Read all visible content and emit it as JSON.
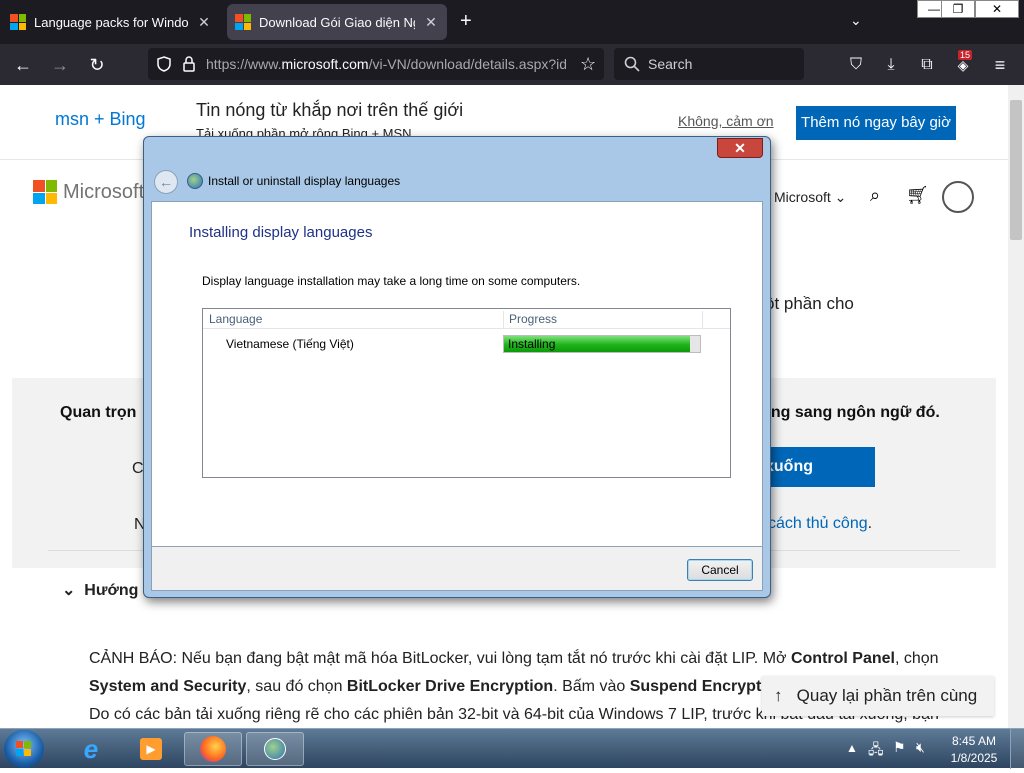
{
  "browser": {
    "tabs": [
      {
        "label": "Language packs for Windows - Mic",
        "active": false
      },
      {
        "label": "Download Gói Giao diện Ngôn ngữ",
        "active": true
      }
    ],
    "url_prefix": "https://www.",
    "url_host": "microsoft.com",
    "url_rest": "/vi-VN/download/details.aspx?id=",
    "search_placeholder": "Search",
    "extensions_badge": "15",
    "window_controls": [
      "—",
      "❐",
      "✕"
    ]
  },
  "page": {
    "banner_brand": "msn + Bing",
    "banner_title": "Tin nóng từ khắp nơi trên thế giới",
    "banner_subtitle": "Tải xuống phần mở rộng Bing + MSN",
    "no_thanks": "Không, cảm ơn",
    "add_now": "Thêm nó ngay bây giờ",
    "ms_logo_text": "Microsoft",
    "all_microsoft": "Microsoft",
    "partial_text_right": "ột phần cho",
    "important_left": "Quan trọn",
    "important_right": "ang sang ngôn ngữ đó.",
    "left_c": "C",
    "left_n": "N",
    "download_btn": "xuống",
    "manual_link": "cách thủ công",
    "guide_left": "Hướng",
    "warning_prefix": "CẢNH BÁO: Nếu bạn đang bật mật mã hóa BitLocker, vui lòng tạm tắt nó trước khi cài đặt LIP. Mở ",
    "warning_b1": "Control Panel",
    "warning_mid1": ", chọn ",
    "warning_b2": "System and Security",
    "warning_mid2": ", sau đó chọn ",
    "warning_b3": "BitLocker Drive Encryption",
    "warning_mid3": ". Bấm vào ",
    "warning_b4": "Suspend Encryption",
    "warning_next": "Do có các bản tải xuống riêng rẽ cho các phiên bản 32-bit và 64-bit của Windows 7 LIP, trước khi bắt đầu tải xuống, bạn",
    "back_to_top": "Quay lại phần trên cùng"
  },
  "dialog": {
    "title": "Install or uninstall display languages",
    "heading": "Installing display languages",
    "description": "Display language installation may take a long time on some computers.",
    "columns": [
      "Language",
      "Progress"
    ],
    "rows": [
      {
        "language": "Vietnamese (Tiếng Việt)",
        "status": "Installing",
        "progress": 0.95
      }
    ],
    "cancel": "Cancel",
    "close": "✕"
  },
  "taskbar": {
    "time": "8:45 AM",
    "date": "1/8/2025"
  },
  "colors": {
    "ms_red": "#f25022",
    "ms_green": "#7fba00",
    "ms_blue": "#00a4ef",
    "ms_yellow": "#ffb900",
    "accent_blue": "#0067b8"
  }
}
